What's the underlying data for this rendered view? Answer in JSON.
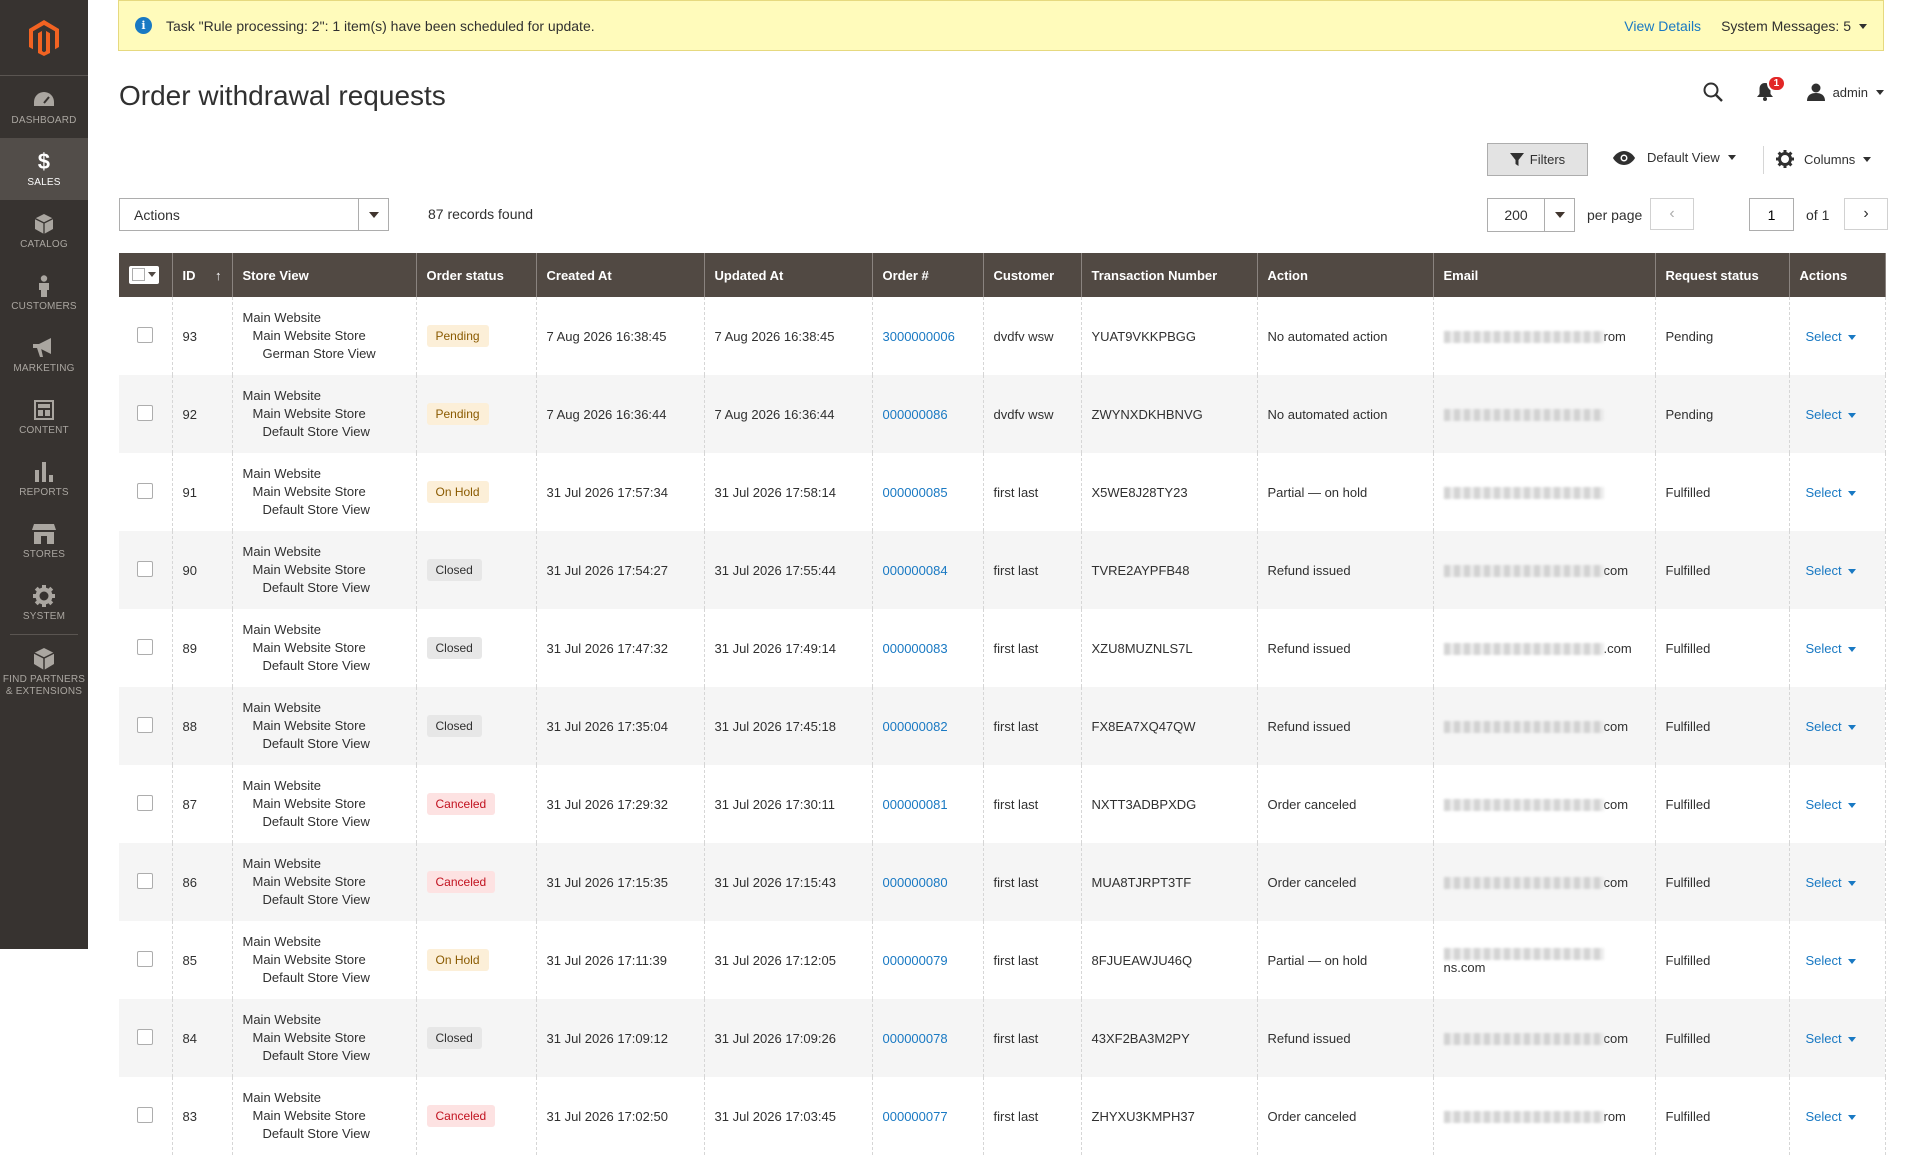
{
  "sidebar": {
    "logo": "magento-logo",
    "items": [
      {
        "label": "DASHBOARD",
        "icon": "dashboard-icon"
      },
      {
        "label": "SALES",
        "icon": "dollar-icon",
        "active": true
      },
      {
        "label": "CATALOG",
        "icon": "cube-icon"
      },
      {
        "label": "CUSTOMERS",
        "icon": "person-icon"
      },
      {
        "label": "MARKETING",
        "icon": "megaphone-icon"
      },
      {
        "label": "CONTENT",
        "icon": "layout-icon"
      },
      {
        "label": "REPORTS",
        "icon": "bar-chart-icon"
      },
      {
        "label": "STORES",
        "icon": "store-icon"
      },
      {
        "label": "SYSTEM",
        "icon": "gear-icon"
      },
      {
        "label": "FIND PARTNERS & EXTENSIONS",
        "icon": "box-icon"
      }
    ]
  },
  "message": {
    "text": "Task \"Rule processing: 2\": 1 item(s) have been scheduled for update.",
    "view_details": "View Details",
    "system_messages": "System Messages: 5"
  },
  "header": {
    "title": "Order withdrawal requests",
    "notifications_count": "1",
    "user": "admin"
  },
  "toolbar": {
    "filters": "Filters",
    "view": "Default View",
    "columns": "Columns",
    "actions": "Actions",
    "records": "87 records found",
    "per_page_value": "200",
    "per_page_label": "per page",
    "page": "1",
    "of_pages": "of 1"
  },
  "colors": {
    "sidebar_bg": "#373330",
    "header_bg": "#514943",
    "link": "#1979c3",
    "message_bg": "#fffbbb"
  },
  "table": {
    "headers": [
      "ID",
      "Store View",
      "Order status",
      "Created At",
      "Updated At",
      "Order #",
      "Customer",
      "Transaction Number",
      "Action",
      "Email",
      "Request status",
      "Actions"
    ],
    "rows": [
      {
        "id": "93",
        "store": [
          "Main Website",
          "Main Website Store",
          "German Store View"
        ],
        "status": "Pending",
        "status_class": "b-pending",
        "created": "7 Aug 2026 16:38:45",
        "updated": "7 Aug 2026 16:38:45",
        "order": "3000000006",
        "customer": "dvdfv wsw",
        "txn": "YUAT9VKKPBGG",
        "action": "No automated action",
        "email_tail": "rom",
        "request": "Pending",
        "select": "Select"
      },
      {
        "id": "92",
        "store": [
          "Main Website",
          "Main Website Store",
          "Default Store View"
        ],
        "status": "Pending",
        "status_class": "b-pending",
        "created": "7 Aug 2026 16:36:44",
        "updated": "7 Aug 2026 16:36:44",
        "order": "000000086",
        "customer": "dvdfv wsw",
        "txn": "ZWYNXDKHBNVG",
        "action": "No automated action",
        "email_tail": "",
        "request": "Pending",
        "select": "Select"
      },
      {
        "id": "91",
        "store": [
          "Main Website",
          "Main Website Store",
          "Default Store View"
        ],
        "status": "On Hold",
        "status_class": "b-hold",
        "created": "31 Jul 2026 17:57:34",
        "updated": "31 Jul 2026 17:58:14",
        "order": "000000085",
        "customer": "first last",
        "txn": "X5WE8J28TY23",
        "action": "Partial — on hold",
        "email_tail": "",
        "request": "Fulfilled",
        "select": "Select"
      },
      {
        "id": "90",
        "store": [
          "Main Website",
          "Main Website Store",
          "Default Store View"
        ],
        "status": "Closed",
        "status_class": "b-closed",
        "created": "31 Jul 2026 17:54:27",
        "updated": "31 Jul 2026 17:55:44",
        "order": "000000084",
        "customer": "first last",
        "txn": "TVRE2AYPFB48",
        "action": "Refund issued",
        "email_tail": "com",
        "request": "Fulfilled",
        "select": "Select"
      },
      {
        "id": "89",
        "store": [
          "Main Website",
          "Main Website Store",
          "Default Store View"
        ],
        "status": "Closed",
        "status_class": "b-closed",
        "created": "31 Jul 2026 17:47:32",
        "updated": "31 Jul 2026 17:49:14",
        "order": "000000083",
        "customer": "first last",
        "txn": "XZU8MUZNLS7L",
        "action": "Refund issued",
        "email_tail": ".com",
        "request": "Fulfilled",
        "select": "Select"
      },
      {
        "id": "88",
        "store": [
          "Main Website",
          "Main Website Store",
          "Default Store View"
        ],
        "status": "Closed",
        "status_class": "b-closed",
        "created": "31 Jul 2026 17:35:04",
        "updated": "31 Jul 2026 17:45:18",
        "order": "000000082",
        "customer": "first last",
        "txn": "FX8EA7XQ47QW",
        "action": "Refund issued",
        "email_tail": "com",
        "request": "Fulfilled",
        "select": "Select"
      },
      {
        "id": "87",
        "store": [
          "Main Website",
          "Main Website Store",
          "Default Store View"
        ],
        "status": "Canceled",
        "status_class": "b-canceled",
        "created": "31 Jul 2026 17:29:32",
        "updated": "31 Jul 2026 17:30:11",
        "order": "000000081",
        "customer": "first last",
        "txn": "NXTT3ADBPXDG",
        "action": "Order canceled",
        "email_tail": "com",
        "request": "Fulfilled",
        "select": "Select"
      },
      {
        "id": "86",
        "store": [
          "Main Website",
          "Main Website Store",
          "Default Store View"
        ],
        "status": "Canceled",
        "status_class": "b-canceled",
        "created": "31 Jul 2026 17:15:35",
        "updated": "31 Jul 2026 17:15:43",
        "order": "000000080",
        "customer": "first last",
        "txn": "MUA8TJRPT3TF",
        "action": "Order canceled",
        "email_tail": "com",
        "request": "Fulfilled",
        "select": "Select"
      },
      {
        "id": "85",
        "store": [
          "Main Website",
          "Main Website Store",
          "Default Store View"
        ],
        "status": "On Hold",
        "status_class": "b-hold",
        "created": "31 Jul 2026 17:11:39",
        "updated": "31 Jul 2026 17:12:05",
        "order": "000000079",
        "customer": "first last",
        "txn": "8FJUEAWJU46Q",
        "action": "Partial — on hold",
        "email_tail": "ns.com",
        "request": "Fulfilled",
        "select": "Select"
      },
      {
        "id": "84",
        "store": [
          "Main Website",
          "Main Website Store",
          "Default Store View"
        ],
        "status": "Closed",
        "status_class": "b-closed",
        "created": "31 Jul 2026 17:09:12",
        "updated": "31 Jul 2026 17:09:26",
        "order": "000000078",
        "customer": "first last",
        "txn": "43XF2BA3M2PY",
        "action": "Refund issued",
        "email_tail": "com",
        "request": "Fulfilled",
        "select": "Select"
      },
      {
        "id": "83",
        "store": [
          "Main Website",
          "Main Website Store",
          "Default Store View"
        ],
        "status": "Canceled",
        "status_class": "b-canceled",
        "created": "31 Jul 2026 17:02:50",
        "updated": "31 Jul 2026 17:03:45",
        "order": "000000077",
        "customer": "first last",
        "txn": "ZHYXU3KMPH37",
        "action": "Order canceled",
        "email_tail": "rom",
        "request": "Fulfilled",
        "select": "Select"
      }
    ]
  }
}
